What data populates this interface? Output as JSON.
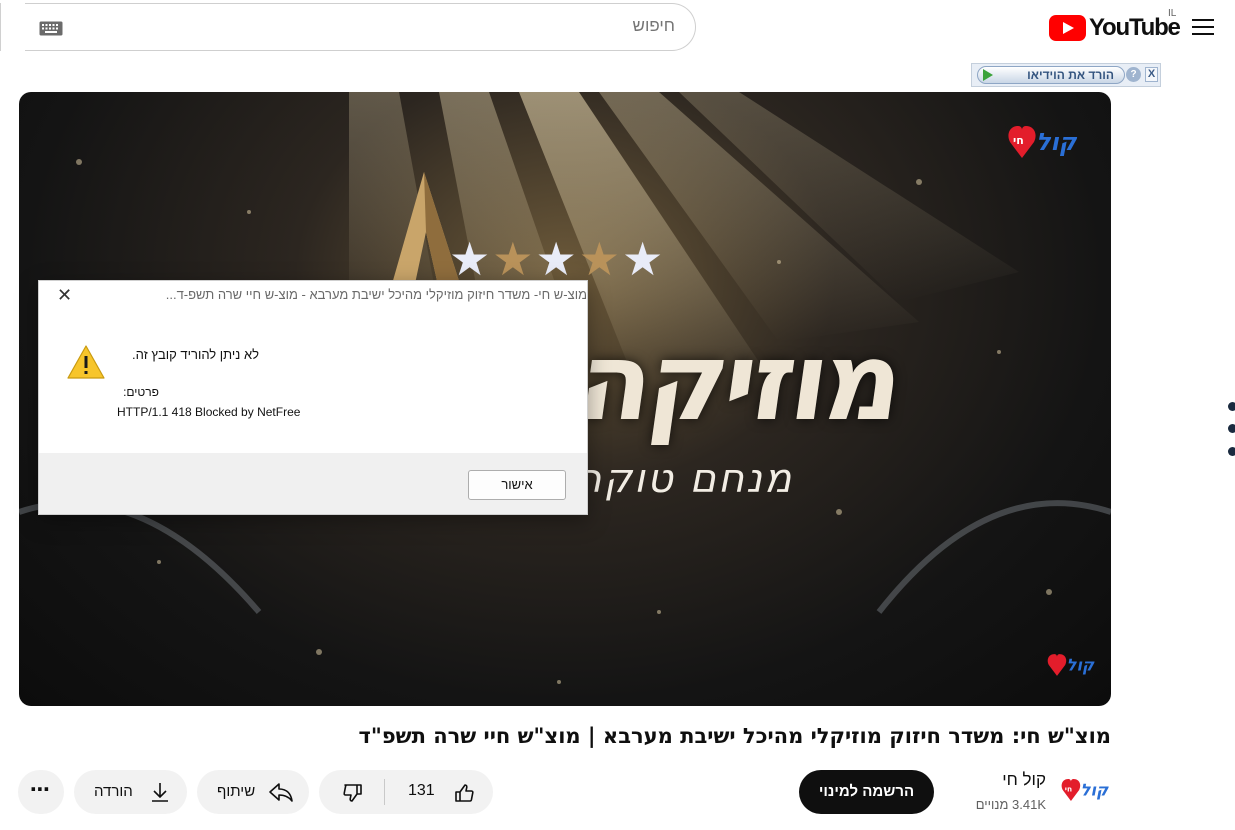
{
  "header": {
    "logo_text": "YouTube",
    "country_code": "IL",
    "search_placeholder": "חיפוש"
  },
  "download_bar": {
    "label": "הורד את הוידיאו",
    "help": "?",
    "close": "X"
  },
  "video": {
    "overlay_title": "מוזיקה",
    "overlay_subtitle": "מנחם טוקר",
    "logo_text": "קול חי"
  },
  "dialog": {
    "title": "מוצ-ש חי- משדר חיזוק מוזיקלי מהיכל ישיבת מערבא - מוצ-ש חיי שרה תשפ-ד...",
    "message": "לא ניתן להוריד קובץ זה.",
    "details_label": "פרטים:",
    "details_value": "HTTP/1.1 418 Blocked by NetFree",
    "ok_label": "אישור",
    "close": "✕"
  },
  "video_title": "מוצ\"ש חי: משדר חיזוק מוזיקלי מהיכל ישיבת מערבא | מוצ\"ש חיי שרה תשפ\"ד",
  "channel": {
    "name": "קול חי",
    "subscribers": "3.41K מנויים",
    "subscribe_label": "הרשמה למינוי"
  },
  "actions": {
    "like_count": "131",
    "share_label": "שיתוף",
    "download_label": "הורדה",
    "more_label": "⋯"
  },
  "colors": {
    "brand_red": "#ff0000",
    "subscribe_bg": "#0f0f0f",
    "pill_bg": "#f2f2f2"
  }
}
